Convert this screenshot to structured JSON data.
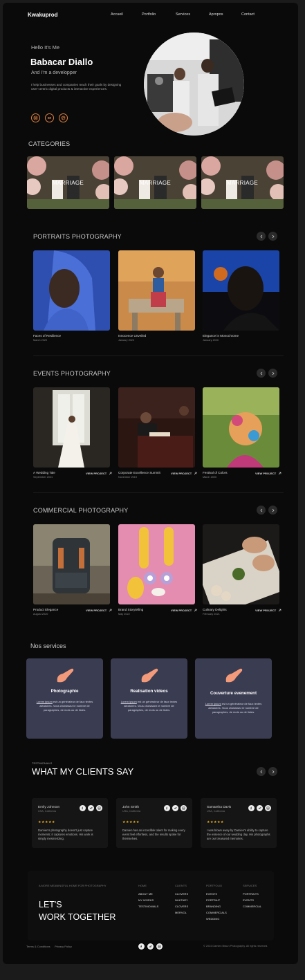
{
  "nav": {
    "logo": "Kwakuprod",
    "items": [
      "Accueil",
      "Portfolio",
      "Services",
      "Apropos",
      "Contact"
    ]
  },
  "hero": {
    "greeting": "Hello It's Me",
    "name": "Babacar Diallo",
    "role": "And I'm a  developper",
    "intro": "I help businesses and companies reach their goals by designing user-centric digital products & interactive experiences.",
    "socials": [
      "instagram-icon",
      "behance-icon",
      "dribbble-icon"
    ]
  },
  "categories": {
    "title": "CATEGORIES",
    "items": [
      "MARRIAGE",
      "MARRIAGE",
      "MARRIAGE"
    ]
  },
  "portraits": {
    "title": "PORTRAITS PHOTOGRAPHY",
    "items": [
      {
        "title": "Faces of Resilience",
        "date": "March 2020"
      },
      {
        "title": "Innocence Unveiled",
        "date": "January 2020"
      },
      {
        "title": "Elegance in Monochrome",
        "date": "January 2020"
      }
    ]
  },
  "events": {
    "title": "EVENTS PHOTOGRAPHY",
    "items": [
      {
        "title": "A Wedding Tale",
        "date": "September 2021",
        "link": "VIEW PROJECT"
      },
      {
        "title": "Corporate Excellence Summit",
        "date": "November 2019",
        "link": "VIEW PROJECT"
      },
      {
        "title": "Festival of Colors",
        "date": "March 2020",
        "link": "VIEW PROJECT"
      }
    ]
  },
  "commercial": {
    "title": "COMMERCIAL PHOTOGRAPHY",
    "items": [
      {
        "title": "Product Elegance",
        "date": "August 2020",
        "link": "VIEW PROJECT"
      },
      {
        "title": "Brand Storytelling",
        "date": "May 2022",
        "link": "VIEW PROJECT"
      },
      {
        "title": "Culinary Delights",
        "date": "February 2021",
        "link": "VIEW PROJECT"
      }
    ]
  },
  "services": {
    "title": "Nos services",
    "items": [
      {
        "title": "Photographie",
        "link": "Lorem ipsum",
        "desc": " est un générateur de faux textes aléatoires. Vous choisissez le nombre de paragraphes, de mots ou de listes."
      },
      {
        "title": "Realisation videos",
        "link": "Lorem ipsum",
        "desc": " est un générateur de faux textes aléatoires. Vous choisissez le nombre de paragraphes, de mots ou de listes."
      },
      {
        "title": "Couverture evenement",
        "link": "Lorem ipsum",
        "desc": " est un générateur de faux textes aléatoires. Vous choisissez le nombre de paragraphes, de mots ou de listes."
      }
    ],
    "accent": "#f29a7a",
    "card_color": "#3a3c52"
  },
  "testimonials": {
    "kicker": "TESTIMONIALS",
    "title": "WHAT MY CLIENTS SAY",
    "stars": "★★★★★",
    "items": [
      {
        "name": "Emily Johnson",
        "location": "USA, California",
        "text": "Damien's photography doesn't just capture moments; it captures emotions. His work is simply mesmerizing."
      },
      {
        "name": "John Smith",
        "location": "USA, California",
        "text": "Damien has an incredible talent for making every event feel effortless, and the results spoke for themselves."
      },
      {
        "name": "Samantha Davis",
        "location": "USA, California",
        "text": "I was blown away by Damien's ability to capture the essence of our wedding day. His photographs are our treasured memories."
      }
    ]
  },
  "footer": {
    "tagline": "A MORE MEANINGFUL HOME FOR PHOTOGRAPHY",
    "cta_line1": "LET'S",
    "cta_line2": "WORK TOGETHER",
    "columns": [
      {
        "head": "HOME",
        "links": [
          "ABOUT ME",
          "MY WORKS",
          "TESTIMONIALS"
        ]
      },
      {
        "head": "CLIENTS",
        "links": [
          "CLOVERS",
          "NUKTARY",
          "CLOVERS",
          "MERVOL"
        ]
      },
      {
        "head": "PORTFOLIO",
        "links": [
          "EVENTS",
          "PORTRAIT",
          "BRANDING",
          "COMMERCIALS",
          "WEDDING"
        ]
      },
      {
        "head": "SERVICES",
        "links": [
          "PORTRAITS",
          "EVENTS",
          "COMMERCIAL"
        ]
      }
    ],
    "terms": "Terms & Conditions",
    "privacy": "Privacy Policy",
    "copyright": "© 2024 Damien Braun Photography. All rights reserved."
  }
}
